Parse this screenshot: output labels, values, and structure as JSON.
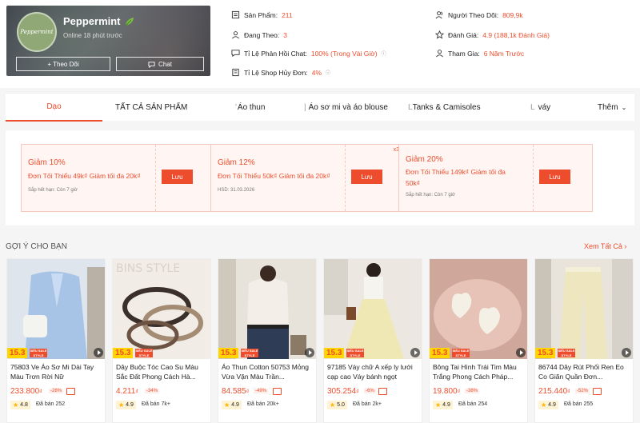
{
  "shop": {
    "name": "Peppermint",
    "avatar_text": "Peppermint",
    "online": "Online 18 phút trước",
    "follow_label": "+ Theo Dõi",
    "chat_label": "Chat"
  },
  "stats": [
    {
      "icon": "product-icon",
      "label": "Sản Phẩm:",
      "value": "211"
    },
    {
      "icon": "following-icon",
      "label": "Đang Theo:",
      "value": "3"
    },
    {
      "icon": "chat-response-icon",
      "label": "Tỉ Lệ Phản Hồi Chat:",
      "value": "100% (Trong Vài Giờ)"
    },
    {
      "icon": "cancel-rate-icon",
      "label": "Tỉ Lệ Shop Hủy Đơn:",
      "value": "4%"
    },
    {
      "icon": "followers-icon",
      "label": "Người Theo Dõi:",
      "value": "809,9k"
    },
    {
      "icon": "star-icon",
      "label": "Đánh Giá:",
      "value": "4.9 (188,1k Đánh Giá)"
    },
    {
      "icon": "joined-icon",
      "label": "Tham Gia:",
      "value": "6 Năm Trước"
    }
  ],
  "tabs": [
    "Dạo",
    "TẤT CẢ SẢN PHẨM",
    "Áo thun",
    "Áo sơ mi và áo blouse",
    "Tanks & Camisoles",
    "váy",
    "Thêm"
  ],
  "vouchers": [
    {
      "title": "Giảm 10%",
      "desc": "Đơn Tối Thiểu 49k₫ Giảm tối đa 20k₫",
      "note": "Sắp hết hạn: Còn 7 giờ",
      "save": "Lưu",
      "tag": ""
    },
    {
      "title": "Giảm 12%",
      "desc": "Đơn Tối Thiểu 50k₫ Giảm tối đa 20k₫",
      "note": "HSD: 31.03.2026",
      "save": "Lưu",
      "tag": "x3"
    },
    {
      "title": "Giảm 20%",
      "desc": "Đơn Tối Thiểu 149k₫ Giảm tối đa 50k₫",
      "note": "Sắp hết hạn: Còn 7 giờ",
      "save": "Lưu",
      "tag": ""
    }
  ],
  "section": {
    "title": "GỢI Ý CHO BẠN",
    "see_all": "Xem Tất Cả"
  },
  "sale_badge": {
    "number": "15.3",
    "label": "SIÊU SALE STYLE"
  },
  "products": [
    {
      "name": "75803 Ve Áo Sơ Mi Dài Tay Màu Trơn Rời Nữ",
      "price": "233.800",
      "currency": "₫",
      "discount": "-28%",
      "rating": "4.8",
      "sold": "Đã bán 252"
    },
    {
      "name": "Dây Buộc Tóc Cao Su Màu Sắc Đất Phong Cách Hà...",
      "price": "4.211",
      "currency": "₫",
      "discount": "-34%",
      "rating": "4.9",
      "sold": "Đã bán 7k+"
    },
    {
      "name": "Áo Thun Cotton 50753 Mỏng Vừa Vặn Màu Trần...",
      "price": "84.585",
      "currency": "₫",
      "discount": "-49%",
      "rating": "4.9",
      "sold": "Đã bán 20k+"
    },
    {
      "name": "97185 Váy chữ A xếp ly lưới cạp cao Váy bánh ngọt",
      "price": "305.254",
      "currency": "₫",
      "discount": "-6%",
      "rating": "5.0",
      "sold": "Đã bán 2k+"
    },
    {
      "name": "Bông Tai Hình Trái Tim Màu Trắng Phong Cách Pháp...",
      "price": "19.800",
      "currency": "₫",
      "discount": "-38%",
      "rating": "4.9",
      "sold": "Đã bán 254"
    },
    {
      "name": "86744 Dây Rút Phối Ren Eo Co Giãn Quần Đơn...",
      "price": "215.440",
      "currency": "₫",
      "discount": "-52%",
      "rating": "4.9",
      "sold": "Đã bán 255"
    }
  ],
  "colors": {
    "accent": "#ee4d2d",
    "badge_yellow": "#ffd400"
  }
}
